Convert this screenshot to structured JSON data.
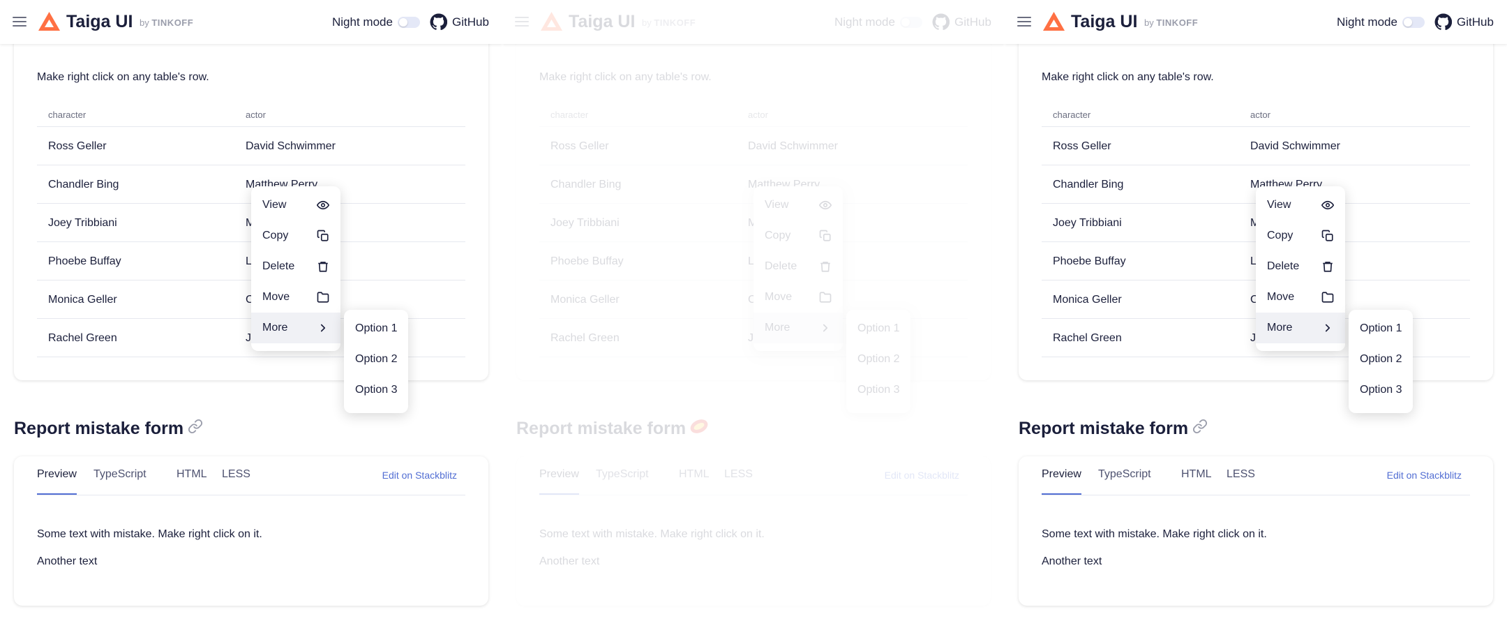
{
  "header": {
    "logo_text": "Taiga UI",
    "logo_by": "by",
    "logo_brand": "TINKOFF",
    "night_mode_label": "Night mode",
    "github_label": "GitHub"
  },
  "table_section": {
    "hint": "Make right click on any table's row.",
    "columns": [
      "character",
      "actor"
    ],
    "rows": [
      {
        "character": "Ross Geller",
        "actor": "David Schwimmer"
      },
      {
        "character": "Chandler Bing",
        "actor": "Matthew Perry"
      },
      {
        "character": "Joey Tribbiani",
        "actor": "M"
      },
      {
        "character": "Phoebe Buffay",
        "actor": "L"
      },
      {
        "character": "Monica Geller",
        "actor": "C"
      },
      {
        "character": "Rachel Green",
        "actor": "Je"
      }
    ]
  },
  "context_menu": {
    "items": [
      {
        "label": "View",
        "icon": "eye-icon"
      },
      {
        "label": "Copy",
        "icon": "copy-icon"
      },
      {
        "label": "Delete",
        "icon": "trash-icon"
      },
      {
        "label": "Move",
        "icon": "folder-icon"
      },
      {
        "label": "More",
        "icon": "chevron-right-icon"
      }
    ],
    "submenu": [
      "Option 1",
      "Option 2",
      "Option 3"
    ]
  },
  "report_section": {
    "title": "Report mistake form",
    "tabs": [
      "Preview",
      "TypeScript",
      "HTML",
      "LESS"
    ],
    "active_tab": "Preview",
    "edit_link": "Edit on Stackblitz",
    "text_line_1": "Some text with mistake. Make right click on it.",
    "text_line_2": "Another text"
  },
  "colors": {
    "accent": "#526ed3",
    "logo_orange": "#ff7043",
    "text": "#1b1f3b",
    "muted": "#6b6e80"
  }
}
